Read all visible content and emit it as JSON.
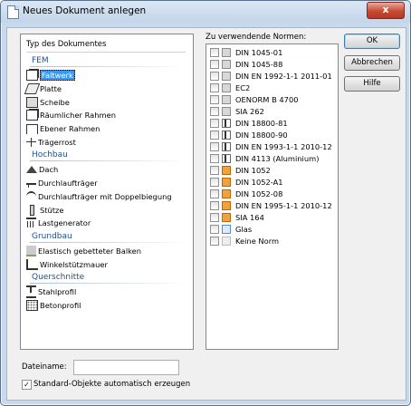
{
  "window": {
    "title": "Neues Dokument anlegen",
    "close_glyph": "x"
  },
  "doc_types": {
    "header": "Typ des Dokumentes",
    "groups": [
      {
        "label": "FEM",
        "items": [
          {
            "label": "Faltwerk",
            "icon": "folded-plate-icon",
            "selected": true
          },
          {
            "label": "Platte",
            "icon": "plate-icon"
          },
          {
            "label": "Scheibe",
            "icon": "wall-disc-icon"
          },
          {
            "label": "Räumlicher Rahmen",
            "icon": "spatial-frame-icon"
          },
          {
            "label": "Ebener Rahmen",
            "icon": "plane-frame-icon"
          },
          {
            "label": "Trägerrost",
            "icon": "grillage-icon"
          }
        ]
      },
      {
        "label": "Hochbau",
        "items": [
          {
            "label": "Dach",
            "icon": "roof-icon"
          },
          {
            "label": "Durchlaufträger",
            "icon": "continuous-beam-icon"
          },
          {
            "label": "Durchlaufträger mit Doppelbiegung",
            "icon": "biaxial-beam-icon"
          },
          {
            "label": "Stütze",
            "icon": "column-icon"
          },
          {
            "label": "Lastgenerator",
            "icon": "load-generator-icon"
          }
        ]
      },
      {
        "label": "Grundbau",
        "items": [
          {
            "label": "Elastisch gebetteter Balken",
            "icon": "elastic-beam-icon"
          },
          {
            "label": "Winkelstützmauer",
            "icon": "retaining-wall-icon"
          }
        ]
      },
      {
        "label": "Querschnitte",
        "items": [
          {
            "label": "Stahlprofil",
            "icon": "steel-profile-icon"
          },
          {
            "label": "Betonprofil",
            "icon": "concrete-profile-icon"
          }
        ]
      }
    ]
  },
  "norms": {
    "label": "Zu verwendende Normen:",
    "items": [
      {
        "label": "DIN 1045-01",
        "material": "concrete",
        "checked": false
      },
      {
        "label": "DIN 1045-88",
        "material": "concrete",
        "checked": false
      },
      {
        "label": "DIN EN 1992-1-1 2011-01",
        "material": "concrete",
        "checked": false
      },
      {
        "label": "EC2",
        "material": "concrete",
        "checked": false
      },
      {
        "label": "OENORM B 4700",
        "material": "concrete",
        "checked": false
      },
      {
        "label": "SIA 262",
        "material": "concrete",
        "checked": false
      },
      {
        "label": "DIN 18800-81",
        "material": "steel",
        "checked": false
      },
      {
        "label": "DIN 18800-90",
        "material": "steel",
        "checked": false
      },
      {
        "label": "DIN EN 1993-1-1 2010-12",
        "material": "steel",
        "checked": false
      },
      {
        "label": "DIN 4113 (Aluminium)",
        "material": "steel",
        "checked": false
      },
      {
        "label": "DIN 1052",
        "material": "wood",
        "checked": false
      },
      {
        "label": "DIN 1052-A1",
        "material": "wood",
        "checked": false
      },
      {
        "label": "DIN 1052-08",
        "material": "wood",
        "checked": false
      },
      {
        "label": "DIN EN 1995-1-1 2010-12",
        "material": "wood",
        "checked": false
      },
      {
        "label": "SIA 164",
        "material": "wood",
        "checked": false
      },
      {
        "label": "Glas",
        "material": "glass",
        "checked": false
      },
      {
        "label": "Keine Norm",
        "material": "none",
        "checked": false
      }
    ]
  },
  "buttons": {
    "ok": "OK",
    "cancel": "Abbrechen",
    "help": "Hilfe"
  },
  "filename": {
    "label": "Dateiname:",
    "value": ""
  },
  "auto_objects": {
    "label": "Standard-Objekte automatisch erzeugen",
    "checked": true,
    "check_glyph": "✓"
  },
  "colors": {
    "title_bar": "#c3d5ea",
    "selection": "#3399ff",
    "group_header": "#1d4f91",
    "close_button": "#c74a33",
    "wood_norm": "#f2a23a"
  }
}
